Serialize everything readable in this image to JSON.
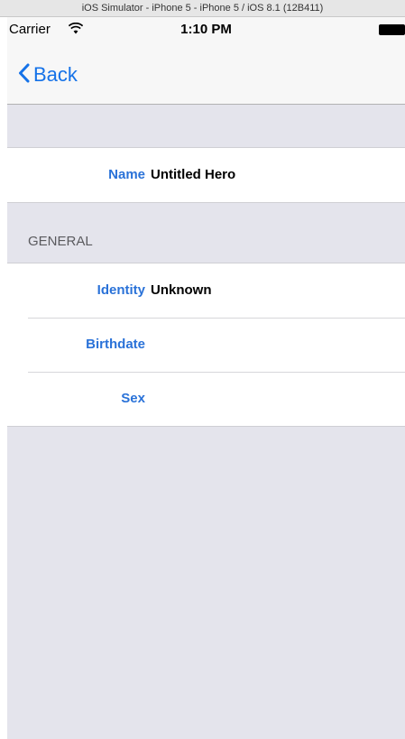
{
  "window": {
    "title": "iOS Simulator - iPhone 5 - iPhone 5 / iOS 8.1 (12B411)"
  },
  "status_bar": {
    "carrier": "Carrier",
    "time": "1:10 PM",
    "wifi_icon": "wifi-icon",
    "battery_icon": "battery-icon"
  },
  "nav": {
    "back_label": "Back",
    "back_icon": "chevron-left-icon"
  },
  "colors": {
    "tint": "#1572e8",
    "label": "#2a72d8",
    "grouped_background": "#e4e4ec"
  },
  "name_section": {
    "rows": [
      {
        "label": "Name",
        "value": "Untitled Hero"
      }
    ]
  },
  "general_section": {
    "header": "GENERAL",
    "rows": [
      {
        "label": "Identity",
        "value": "Unknown"
      },
      {
        "label": "Birthdate",
        "value": ""
      },
      {
        "label": "Sex",
        "value": ""
      }
    ]
  }
}
